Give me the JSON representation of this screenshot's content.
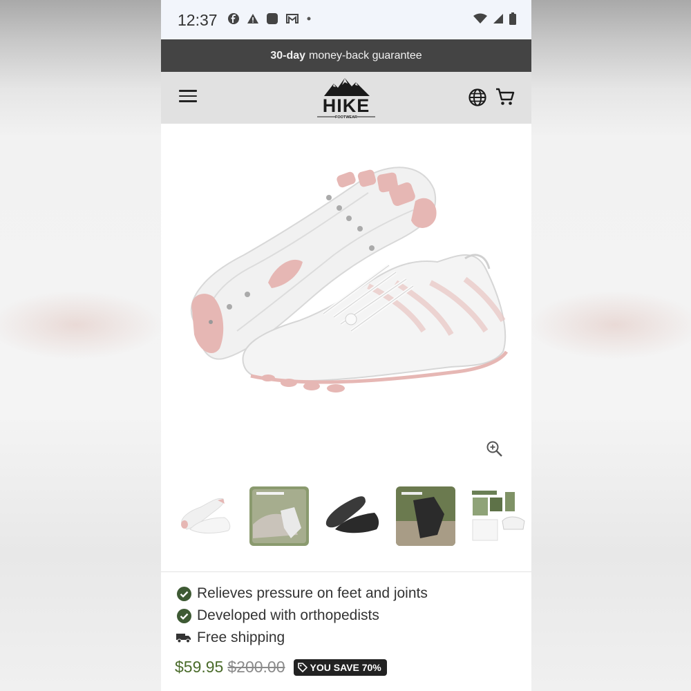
{
  "status_bar": {
    "time": "12:37",
    "notification_icons": [
      "facebook-icon",
      "warning-icon",
      "app-square-icon",
      "gmail-icon",
      "dot-icon"
    ],
    "system_icons": [
      "wifi-icon",
      "signal-icon",
      "battery-icon"
    ]
  },
  "announcement": {
    "bold": "30-day",
    "text": "money-back guarantee"
  },
  "header": {
    "logo_text": "HIKE",
    "logo_subtext": "FOOTWEAR",
    "menu_icon": "hamburger-menu-icon",
    "locale_icon": "globe-icon",
    "cart_icon": "cart-icon"
  },
  "gallery": {
    "main_image": "white-pink-barefoot-shoes",
    "zoom_icon": "zoom-in-icon",
    "thumbnails": [
      "white-pink-shoes",
      "stretching-feet-photo",
      "black-shoes",
      "outdoor-walking-photo",
      "package-contents"
    ]
  },
  "features": [
    {
      "icon": "check-circle-icon",
      "text": "Relieves pressure on feet and joints"
    },
    {
      "icon": "check-circle-icon",
      "text": "Developed with orthopedists"
    },
    {
      "icon": "truck-icon",
      "text": "Free shipping"
    }
  ],
  "pricing": {
    "price": "$59.95",
    "compare_at": "$200.00",
    "save_badge": "YOU SAVE 70%",
    "price_color": "#4a6b2a"
  },
  "colors": {
    "announcement_bg": "#444444",
    "header_bg": "#e1e1e1",
    "check_green": "#3e5a34"
  }
}
